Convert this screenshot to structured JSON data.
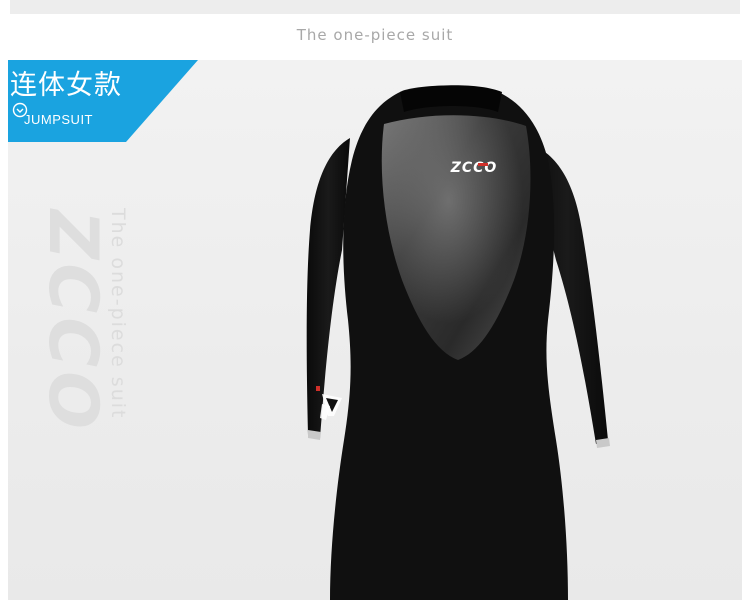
{
  "header": {
    "subtitle": "The one-piece suit"
  },
  "banner": {
    "title": "连体女款",
    "icon": "chevron-down-circle-icon",
    "subtitle": "JUMPSUIT",
    "color": "#1aa3e0"
  },
  "watermark": {
    "brand": "ZCCO",
    "tagline": "The one-piece suit"
  },
  "product": {
    "chest_logo": "ZCCO",
    "suit_color": "#0d0d0d"
  }
}
